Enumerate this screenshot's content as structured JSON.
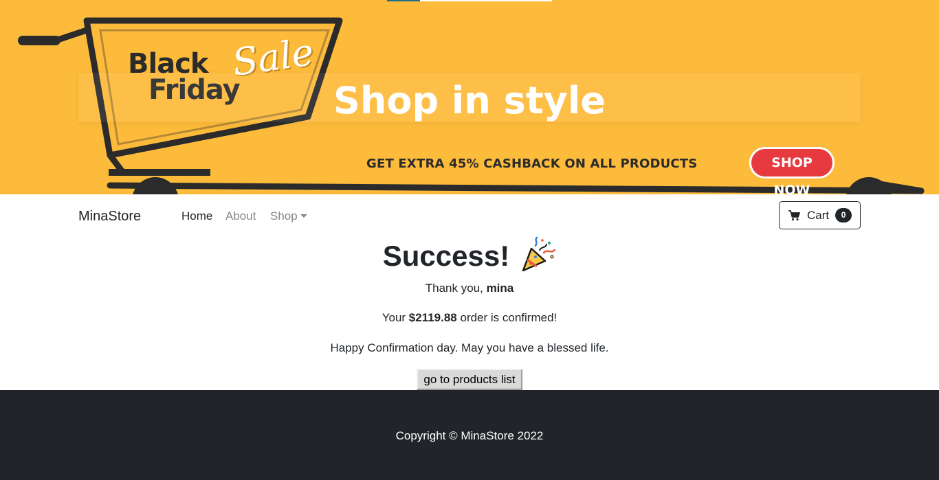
{
  "hero": {
    "badge_line1": "Black",
    "badge_line2": "Friday",
    "badge_script": "Sale",
    "title": "Shop in style",
    "promo_text": "GET EXTRA 45% CASHBACK ON ALL PRODUCTS",
    "promo_button": "SHOP NOW",
    "bg_color": "#fdbb3b"
  },
  "navbar": {
    "brand": "MinaStore",
    "links": [
      {
        "label": "Home",
        "active": true
      },
      {
        "label": "About",
        "active": false
      },
      {
        "label": "Shop",
        "active": false
      }
    ],
    "cart": {
      "icon": "cart-icon",
      "label": "Cart",
      "count": "0"
    }
  },
  "main": {
    "title": "Success!",
    "title_icon": "party-popper-icon",
    "thanks_prefix": "Thank you, ",
    "user_name": "mina",
    "order_prefix": "Your ",
    "order_total": "$2119.88",
    "order_suffix": " order is confirmed!",
    "message": "Happy Confirmation day. May you have a blessed life.",
    "button_label": "go to products list"
  },
  "footer": {
    "copyright": "Copyright © MinaStore 2022",
    "bg_color": "#212529"
  }
}
